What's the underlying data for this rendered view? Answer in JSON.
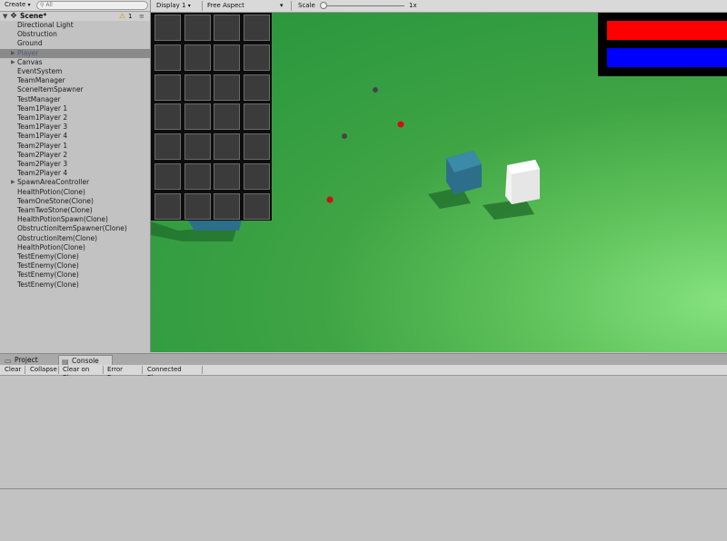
{
  "hierarchy": {
    "create_label": "Create",
    "create_arrow": "▾",
    "search_placeholder": "All",
    "scene_name": "Scene*",
    "warning_count": "1",
    "items": [
      {
        "label": "Directional Light",
        "expandable": false,
        "selected": false
      },
      {
        "label": "Obstruction",
        "expandable": false,
        "selected": false
      },
      {
        "label": "Ground",
        "expandable": false,
        "selected": false
      },
      {
        "label": "Player",
        "expandable": true,
        "selected": true
      },
      {
        "label": "Canvas",
        "expandable": true,
        "selected": false
      },
      {
        "label": "EventSystem",
        "expandable": false,
        "selected": false
      },
      {
        "label": "TeamManager",
        "expandable": false,
        "selected": false
      },
      {
        "label": "SceneItemSpawner",
        "expandable": false,
        "selected": false
      },
      {
        "label": "TestManager",
        "expandable": false,
        "selected": false
      },
      {
        "label": "Team1Player 1",
        "expandable": false,
        "selected": false
      },
      {
        "label": "Team1Player 2",
        "expandable": false,
        "selected": false
      },
      {
        "label": "Team1Player 3",
        "expandable": false,
        "selected": false
      },
      {
        "label": "Team1Player 4",
        "expandable": false,
        "selected": false
      },
      {
        "label": "Team2Player 1",
        "expandable": false,
        "selected": false
      },
      {
        "label": "Team2Player 2",
        "expandable": false,
        "selected": false
      },
      {
        "label": "Team2Player 3",
        "expandable": false,
        "selected": false
      },
      {
        "label": "Team2Player 4",
        "expandable": false,
        "selected": false
      },
      {
        "label": "SpawnAreaController",
        "expandable": true,
        "selected": false
      },
      {
        "label": "HealthPotion(Clone)",
        "expandable": false,
        "selected": false
      },
      {
        "label": "TeamOneStone(Clone)",
        "expandable": false,
        "selected": false
      },
      {
        "label": "TeamTwoStone(Clone)",
        "expandable": false,
        "selected": false
      },
      {
        "label": "HealthPotionSpawn(Clone)",
        "expandable": false,
        "selected": false
      },
      {
        "label": "ObstructionItemSpawner(Clone)",
        "expandable": false,
        "selected": false
      },
      {
        "label": "ObstructionItem(Clone)",
        "expandable": false,
        "selected": false
      },
      {
        "label": "HealthPotion(Clone)",
        "expandable": false,
        "selected": false
      },
      {
        "label": "TestEnemy(Clone)",
        "expandable": false,
        "selected": false
      },
      {
        "label": "TestEnemy(Clone)",
        "expandable": false,
        "selected": false
      },
      {
        "label": "TestEnemy(Clone)",
        "expandable": false,
        "selected": false
      },
      {
        "label": "TestEnemy(Clone)",
        "expandable": false,
        "selected": false
      }
    ]
  },
  "game_view": {
    "display_label": "Display 1",
    "aspect_label": "Free Aspect",
    "dropdown_arrow": "▾",
    "scale_label": "Scale",
    "scale_value": "1x",
    "inventory": {
      "rows": 7,
      "cols": 4
    },
    "health_bar_colors": {
      "red": "#ff0000",
      "blue": "#0000ff"
    },
    "ground_color": "#34a043"
  },
  "bottom_panel": {
    "tabs": [
      {
        "label": "Project",
        "icon": "folder-icon",
        "glyph": "▭",
        "active": false
      },
      {
        "label": "Console",
        "icon": "console-icon",
        "glyph": "▤",
        "active": true
      }
    ],
    "toolbar": {
      "clear": "Clear",
      "collapse": "Collapse",
      "clear_on_play": "Clear on Play",
      "error_pause": "Error Pause",
      "connected_player": "Connected Player",
      "dropdown_arrow": "▾"
    }
  },
  "icons": {
    "scene": "unity-scene-icon",
    "warning": "warning-icon",
    "search": "search-icon"
  }
}
